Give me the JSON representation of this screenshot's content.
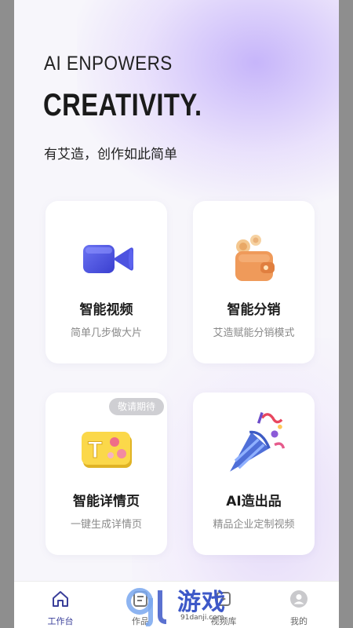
{
  "hero": {
    "line1": "AI ENPOWERS",
    "line2": "CREATIVITY.",
    "tagline": "有艾造，创作如此简单"
  },
  "cards": [
    {
      "title": "智能视频",
      "subtitle": "简单几步做大片",
      "icon": "video-camera-icon"
    },
    {
      "title": "智能分销",
      "subtitle": "艾造赋能分销模式",
      "icon": "wallet-coins-icon"
    },
    {
      "title": "智能详情页",
      "subtitle": "一键生成详情页",
      "icon": "t-card-icon",
      "badge": "敬请期待"
    },
    {
      "title": "AI造出品",
      "subtitle": "精品企业定制视频",
      "icon": "party-popper-icon"
    }
  ],
  "tabbar": {
    "items": [
      {
        "label": "工作台",
        "icon": "home-icon",
        "active": true
      },
      {
        "label": "作品",
        "icon": "document-icon"
      },
      {
        "label": "视频库",
        "icon": "library-icon"
      },
      {
        "label": "我的",
        "icon": "user-icon"
      }
    ]
  },
  "watermark": {
    "brand": "游戏",
    "site": "91danji.com"
  },
  "colors": {
    "accent": "#3a3f9a",
    "background": "#f7f6fb",
    "card": "#ffffff"
  }
}
